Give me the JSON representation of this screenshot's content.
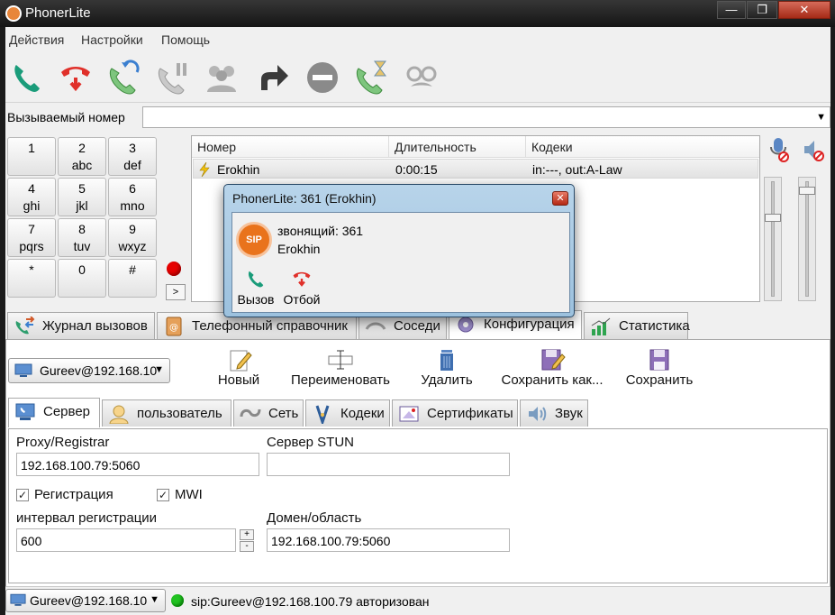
{
  "window": {
    "title": "PhonerLite",
    "minimize": "—",
    "maximize": "❐",
    "close": "✕"
  },
  "menu": [
    "Действия",
    "Настройки",
    "Помощь"
  ],
  "toolbar_icons": [
    "call-icon",
    "hangup-icon",
    "transfer-call-icon",
    "hold-icon",
    "conference-icon",
    "forward-icon",
    "do-not-disturb-icon",
    "callback-icon",
    "incognito-icon"
  ],
  "number_row": {
    "label": "Вызываемый номер",
    "value": ""
  },
  "dialpad": [
    {
      "digit": "1",
      "letters": ""
    },
    {
      "digit": "2",
      "letters": "abc"
    },
    {
      "digit": "3",
      "letters": "def"
    },
    {
      "digit": "4",
      "letters": "ghi"
    },
    {
      "digit": "5",
      "letters": "jkl"
    },
    {
      "digit": "6",
      "letters": "mno"
    },
    {
      "digit": "7",
      "letters": "pqrs"
    },
    {
      "digit": "8",
      "letters": "tuv"
    },
    {
      "digit": "9",
      "letters": "wxyz"
    },
    {
      "digit": "*",
      "letters": ""
    },
    {
      "digit": "0",
      "letters": ""
    },
    {
      "digit": "#",
      "letters": ""
    }
  ],
  "dialpad_arrow": ">",
  "calls": {
    "headers": [
      "Номер",
      "Длительность",
      "Кодеки"
    ],
    "rows": [
      {
        "number": "Erokhin",
        "duration": "0:00:15",
        "codecs": "in:---, out:A-Law"
      }
    ]
  },
  "volume": {
    "mic_level": 0.7,
    "speaker_level": 0.95
  },
  "main_tabs": [
    {
      "label": "Журнал вызовов",
      "icon": "call-log-icon"
    },
    {
      "label": "Телефонный справочник",
      "icon": "phonebook-icon"
    },
    {
      "label": "Соседи",
      "icon": "neighbors-icon"
    },
    {
      "label": "Конфигурация",
      "icon": "config-icon"
    },
    {
      "label": "Статистика",
      "icon": "statistics-icon"
    }
  ],
  "config": {
    "profile": "Gureev@192.168.10",
    "actions": [
      {
        "label": "Новый",
        "icon": "pencil-icon"
      },
      {
        "label": "Переименовать",
        "icon": "rename-icon"
      },
      {
        "label": "Удалить",
        "icon": "trash-icon"
      },
      {
        "label": "Сохранить как...",
        "icon": "save-as-icon"
      },
      {
        "label": "Сохранить",
        "icon": "save-icon"
      }
    ],
    "sub_tabs": [
      {
        "label": "Сервер",
        "icon": "server-icon"
      },
      {
        "label": "пользователь",
        "icon": "user-icon"
      },
      {
        "label": "Сеть",
        "icon": "network-icon"
      },
      {
        "label": "Кодеки",
        "icon": "codecs-icon"
      },
      {
        "label": "Сертификаты",
        "icon": "certificate-icon"
      },
      {
        "label": "Звук",
        "icon": "sound-icon"
      }
    ],
    "server": {
      "proxy_label": "Proxy/Registrar",
      "proxy_value": "192.168.100.79:5060",
      "stun_label": "Сервер STUN",
      "stun_value": "",
      "registration_label": "Регистрация",
      "registration_checked": true,
      "mwi_label": "MWI",
      "mwi_checked": true,
      "interval_label": "интервал регистрации",
      "interval_value": "600",
      "domain_label": "Домен/область",
      "domain_value": "192.168.100.79:5060"
    }
  },
  "status": {
    "profile": "Gureev@192.168.10",
    "text": "sip:Gureev@192.168.100.79 авторизован",
    "color": "#22c322"
  },
  "popup": {
    "title": "PhonerLite: 361 (Erokhin)",
    "badge": "SIP",
    "caller_line": "звонящий: 361",
    "caller_name": "Erokhin",
    "answer": "Вызов",
    "reject": "Отбой"
  },
  "colors": {
    "call_green": "#1a9c7a",
    "hangup_red": "#e0302a",
    "accent_orange": "#e9731c"
  }
}
